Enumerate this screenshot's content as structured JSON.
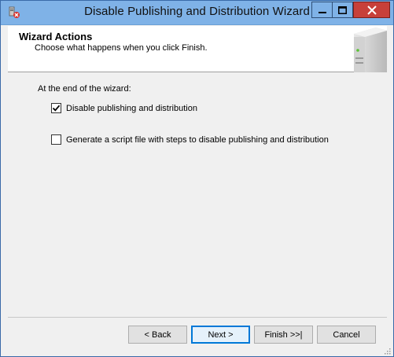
{
  "window": {
    "title": "Disable Publishing and Distribution Wizard"
  },
  "banner": {
    "title": "Wizard Actions",
    "subtitle": "Choose what happens when you click Finish."
  },
  "content": {
    "label": "At the end of the wizard:",
    "options": [
      {
        "label": "Disable publishing and distribution",
        "checked": true
      },
      {
        "label": "Generate a script file with steps to disable publishing and distribution",
        "checked": false
      }
    ]
  },
  "buttons": {
    "back": "< Back",
    "next": "Next >",
    "finish": "Finish >>|",
    "cancel": "Cancel"
  },
  "icons": {
    "minimize": "minimize-icon",
    "maximize": "maximize-icon",
    "close": "close-icon",
    "app": "app-icon"
  },
  "colors": {
    "titlebar": "#7fb2e7",
    "close": "#c7403a",
    "focus": "#0078d7"
  }
}
